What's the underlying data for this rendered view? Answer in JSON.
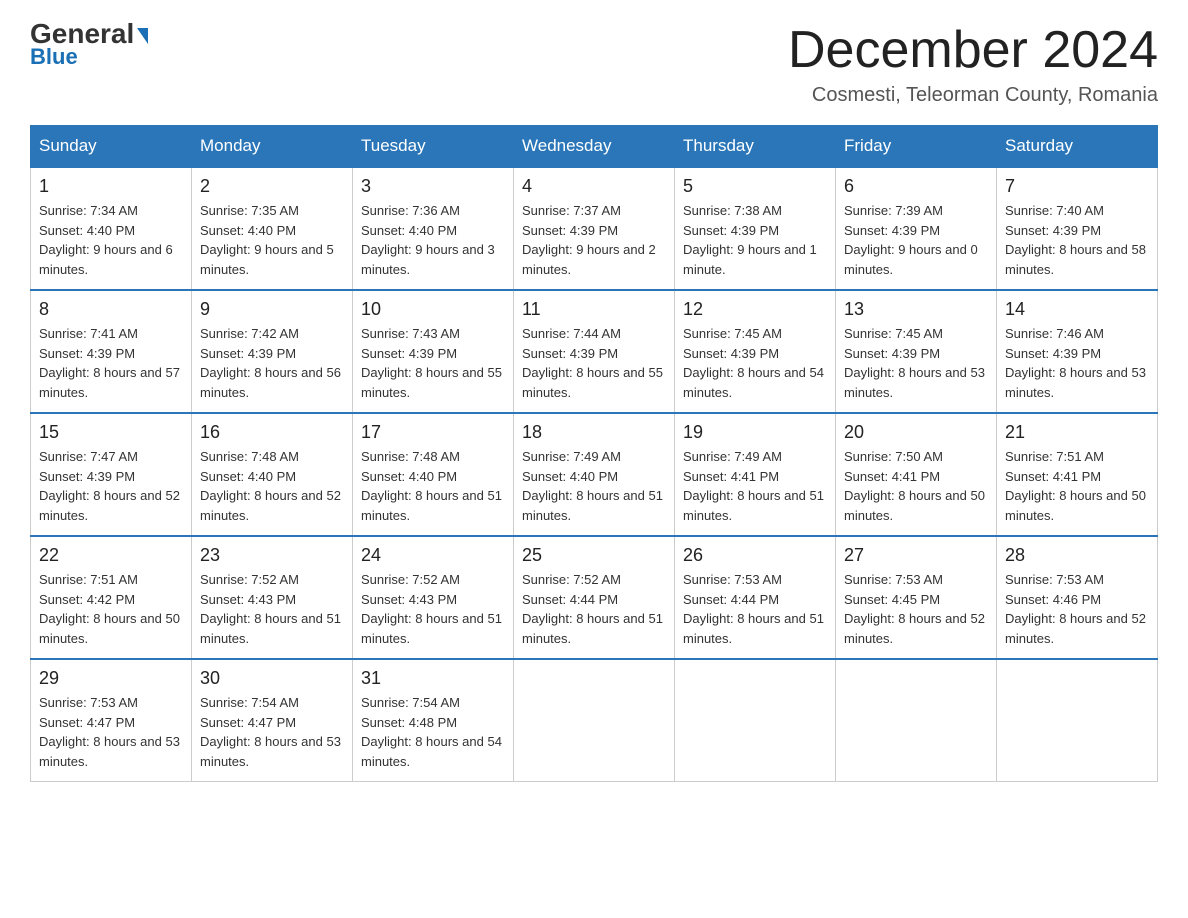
{
  "logo": {
    "text_general": "General",
    "triangle": "▶",
    "text_blue": "Blue"
  },
  "header": {
    "month_title": "December 2024",
    "subtitle": "Cosmesti, Teleorman County, Romania"
  },
  "weekdays": [
    "Sunday",
    "Monday",
    "Tuesday",
    "Wednesday",
    "Thursday",
    "Friday",
    "Saturday"
  ],
  "weeks": [
    [
      {
        "day": "1",
        "sunrise": "7:34 AM",
        "sunset": "4:40 PM",
        "daylight": "9 hours and 6 minutes."
      },
      {
        "day": "2",
        "sunrise": "7:35 AM",
        "sunset": "4:40 PM",
        "daylight": "9 hours and 5 minutes."
      },
      {
        "day": "3",
        "sunrise": "7:36 AM",
        "sunset": "4:40 PM",
        "daylight": "9 hours and 3 minutes."
      },
      {
        "day": "4",
        "sunrise": "7:37 AM",
        "sunset": "4:39 PM",
        "daylight": "9 hours and 2 minutes."
      },
      {
        "day": "5",
        "sunrise": "7:38 AM",
        "sunset": "4:39 PM",
        "daylight": "9 hours and 1 minute."
      },
      {
        "day": "6",
        "sunrise": "7:39 AM",
        "sunset": "4:39 PM",
        "daylight": "9 hours and 0 minutes."
      },
      {
        "day": "7",
        "sunrise": "7:40 AM",
        "sunset": "4:39 PM",
        "daylight": "8 hours and 58 minutes."
      }
    ],
    [
      {
        "day": "8",
        "sunrise": "7:41 AM",
        "sunset": "4:39 PM",
        "daylight": "8 hours and 57 minutes."
      },
      {
        "day": "9",
        "sunrise": "7:42 AM",
        "sunset": "4:39 PM",
        "daylight": "8 hours and 56 minutes."
      },
      {
        "day": "10",
        "sunrise": "7:43 AM",
        "sunset": "4:39 PM",
        "daylight": "8 hours and 55 minutes."
      },
      {
        "day": "11",
        "sunrise": "7:44 AM",
        "sunset": "4:39 PM",
        "daylight": "8 hours and 55 minutes."
      },
      {
        "day": "12",
        "sunrise": "7:45 AM",
        "sunset": "4:39 PM",
        "daylight": "8 hours and 54 minutes."
      },
      {
        "day": "13",
        "sunrise": "7:45 AM",
        "sunset": "4:39 PM",
        "daylight": "8 hours and 53 minutes."
      },
      {
        "day": "14",
        "sunrise": "7:46 AM",
        "sunset": "4:39 PM",
        "daylight": "8 hours and 53 minutes."
      }
    ],
    [
      {
        "day": "15",
        "sunrise": "7:47 AM",
        "sunset": "4:39 PM",
        "daylight": "8 hours and 52 minutes."
      },
      {
        "day": "16",
        "sunrise": "7:48 AM",
        "sunset": "4:40 PM",
        "daylight": "8 hours and 52 minutes."
      },
      {
        "day": "17",
        "sunrise": "7:48 AM",
        "sunset": "4:40 PM",
        "daylight": "8 hours and 51 minutes."
      },
      {
        "day": "18",
        "sunrise": "7:49 AM",
        "sunset": "4:40 PM",
        "daylight": "8 hours and 51 minutes."
      },
      {
        "day": "19",
        "sunrise": "7:49 AM",
        "sunset": "4:41 PM",
        "daylight": "8 hours and 51 minutes."
      },
      {
        "day": "20",
        "sunrise": "7:50 AM",
        "sunset": "4:41 PM",
        "daylight": "8 hours and 50 minutes."
      },
      {
        "day": "21",
        "sunrise": "7:51 AM",
        "sunset": "4:41 PM",
        "daylight": "8 hours and 50 minutes."
      }
    ],
    [
      {
        "day": "22",
        "sunrise": "7:51 AM",
        "sunset": "4:42 PM",
        "daylight": "8 hours and 50 minutes."
      },
      {
        "day": "23",
        "sunrise": "7:52 AM",
        "sunset": "4:43 PM",
        "daylight": "8 hours and 51 minutes."
      },
      {
        "day": "24",
        "sunrise": "7:52 AM",
        "sunset": "4:43 PM",
        "daylight": "8 hours and 51 minutes."
      },
      {
        "day": "25",
        "sunrise": "7:52 AM",
        "sunset": "4:44 PM",
        "daylight": "8 hours and 51 minutes."
      },
      {
        "day": "26",
        "sunrise": "7:53 AM",
        "sunset": "4:44 PM",
        "daylight": "8 hours and 51 minutes."
      },
      {
        "day": "27",
        "sunrise": "7:53 AM",
        "sunset": "4:45 PM",
        "daylight": "8 hours and 52 minutes."
      },
      {
        "day": "28",
        "sunrise": "7:53 AM",
        "sunset": "4:46 PM",
        "daylight": "8 hours and 52 minutes."
      }
    ],
    [
      {
        "day": "29",
        "sunrise": "7:53 AM",
        "sunset": "4:47 PM",
        "daylight": "8 hours and 53 minutes."
      },
      {
        "day": "30",
        "sunrise": "7:54 AM",
        "sunset": "4:47 PM",
        "daylight": "8 hours and 53 minutes."
      },
      {
        "day": "31",
        "sunrise": "7:54 AM",
        "sunset": "4:48 PM",
        "daylight": "8 hours and 54 minutes."
      },
      null,
      null,
      null,
      null
    ]
  ],
  "labels": {
    "sunrise": "Sunrise:",
    "sunset": "Sunset:",
    "daylight": "Daylight:"
  }
}
